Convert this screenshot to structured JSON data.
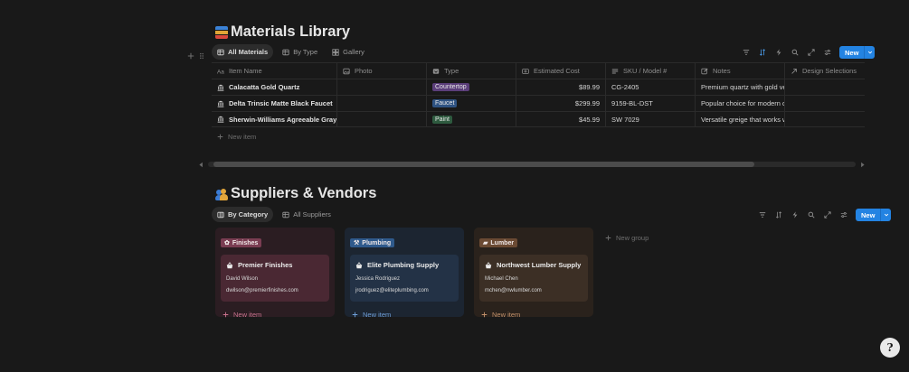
{
  "materials": {
    "title": "Materials Library",
    "views": [
      {
        "label": "All Materials",
        "icon": "table-icon"
      },
      {
        "label": "By Type",
        "icon": "table-icon"
      },
      {
        "label": "Gallery",
        "icon": "gallery-icon"
      }
    ],
    "new_button": "New",
    "columns": [
      {
        "label": "Item Name",
        "icon": "text-icon"
      },
      {
        "label": "Photo",
        "icon": "image-icon"
      },
      {
        "label": "Type",
        "icon": "select-icon"
      },
      {
        "label": "Estimated Cost",
        "icon": "currency-icon"
      },
      {
        "label": "SKU / Model #",
        "icon": "text-lines-icon"
      },
      {
        "label": "Notes",
        "icon": "edit-icon"
      },
      {
        "label": "Design Selections",
        "icon": "relation-arrow-icon"
      }
    ],
    "rows": [
      {
        "name": "Calacatta Gold Quartz",
        "type": "Countertop",
        "type_color": "#5b3e7a",
        "cost": "$89.99",
        "sku": "CG-2405",
        "notes": "Premium quartz with gold veining"
      },
      {
        "name": "Delta Trinsic Matte Black Faucet",
        "type": "Faucet",
        "type_color": "#2f5382",
        "cost": "$299.99",
        "sku": "9159-BL-DST",
        "notes": "Popular choice for modern designs"
      },
      {
        "name": "Sherwin-Williams Agreeable Gray",
        "type": "Paint",
        "type_color": "#2e5a3f",
        "cost": "$45.99",
        "sku": "SW 7029",
        "notes": "Versatile greige that works well"
      }
    ],
    "new_item": "New item"
  },
  "suppliers": {
    "title": "Suppliers & Vendors",
    "views": [
      {
        "label": "By Category",
        "icon": "board-icon"
      },
      {
        "label": "All Suppliers",
        "icon": "table-icon"
      }
    ],
    "new_button": "New",
    "groups": [
      {
        "tag": "Finishes",
        "tag_bg": "#7a3d52",
        "col_bg": "#2b1d22",
        "card_bg": "#4a2833",
        "new_color": "#c9728d",
        "card": {
          "name": "Premier Finishes",
          "contact": "David Wilson",
          "email": "dwilson@premierfinishes.com"
        }
      },
      {
        "tag": "Plumbing",
        "tag_bg": "#2f5a8c",
        "col_bg": "#1c2531",
        "card_bg": "#233246",
        "new_color": "#6f9fd8",
        "card": {
          "name": "Elite Plumbing Supply",
          "contact": "Jessica Rodriguez",
          "email": "jrodriguez@eliteplumbing.com"
        }
      },
      {
        "tag": "Lumber",
        "tag_bg": "#6b4a33",
        "col_bg": "#2a221c",
        "card_bg": "#3c2f25",
        "new_color": "#c2906a",
        "card": {
          "name": "Northwest Lumber Supply",
          "contact": "Michael Chen",
          "email": "mchen@nwlumber.com"
        }
      }
    ],
    "new_item": "New item",
    "new_group": "New group"
  },
  "help_button": "?"
}
